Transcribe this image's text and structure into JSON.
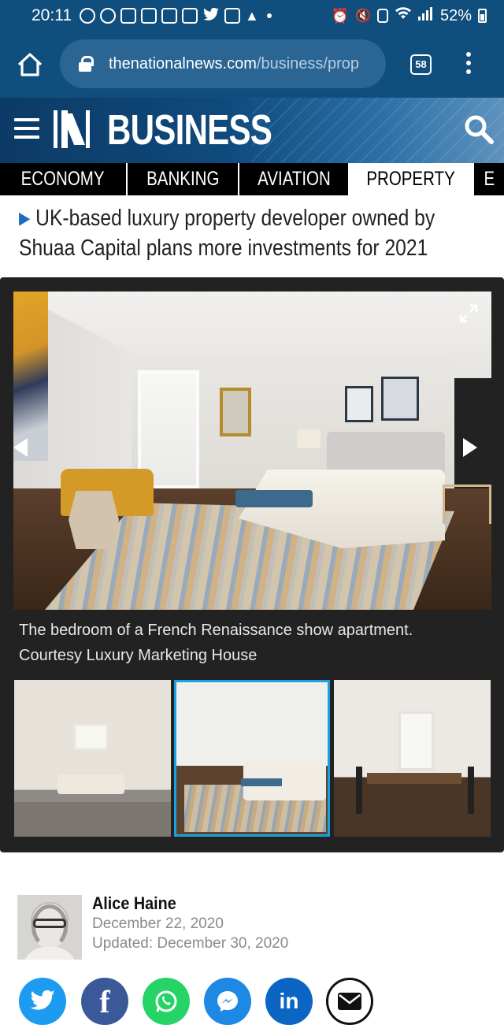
{
  "status_bar": {
    "time": "20:11",
    "battery": "52%",
    "notification_icons": [
      "spotify-icon",
      "whatsapp-icon",
      "gmail-icon",
      "instagram-icon",
      "instagram-icon",
      "app-icon",
      "twitter-icon",
      "gmail-icon",
      "tinder-icon"
    ],
    "system_icons": [
      "alarm-icon",
      "mute-icon",
      "nfc-icon",
      "wifi-icon",
      "signal-icon",
      "battery-icon"
    ]
  },
  "browser": {
    "url_domain": "thenationalnews.com",
    "url_path": "/business/prop",
    "tab_count": "58"
  },
  "site": {
    "section_title": "BUSINESS",
    "accent_color": "#0f4e7d"
  },
  "nav": {
    "items": [
      {
        "label": "ECONOMY"
      },
      {
        "label": "BANKING"
      },
      {
        "label": "AVIATION"
      },
      {
        "label": "PROPERTY"
      },
      {
        "label": "E"
      }
    ],
    "active": "PROPERTY"
  },
  "article": {
    "headline": "UK-based luxury property developer owned by Shuaa Capital plans more investments for 2021"
  },
  "gallery": {
    "caption_line1": "The bedroom of a French Renaissance show apartment.",
    "caption_line2": "Courtesy Luxury Marketing House",
    "thumbnails": [
      "bathroom",
      "bedroom",
      "dining-room"
    ],
    "selected_index": 1,
    "selected_border_color": "#1aa1e0"
  },
  "author": {
    "name": "Alice Haine",
    "published": "December 22, 2020",
    "updated": "Updated: December 30, 2020"
  },
  "share": {
    "facebook_glyph": "f",
    "linkedin_glyph": "in",
    "buttons": [
      "twitter-icon",
      "facebook-icon",
      "whatsapp-icon",
      "messenger-icon",
      "linkedin-icon",
      "email-icon"
    ]
  }
}
